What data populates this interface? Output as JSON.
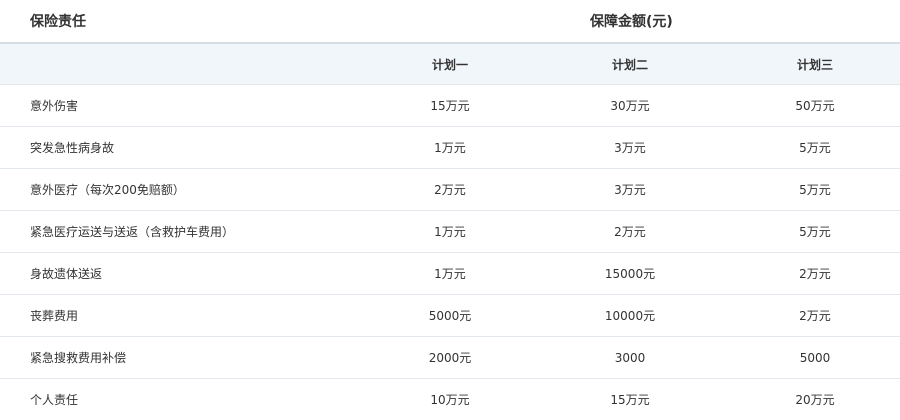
{
  "table": {
    "header_left": "保险责任",
    "header_right": "保障金额(元)",
    "plans": [
      "计划一",
      "计划二",
      "计划三"
    ],
    "rows": [
      {
        "item": "意外伤害",
        "plan1": "15万元",
        "plan2": "30万元",
        "plan3": "50万元"
      },
      {
        "item": "突发急性病身故",
        "plan1": "1万元",
        "plan2": "3万元",
        "plan3": "5万元"
      },
      {
        "item": "意外医疗（每次200免赔额）",
        "plan1": "2万元",
        "plan2": "3万元",
        "plan3": "5万元"
      },
      {
        "item": "紧急医疗运送与送返（含救护车费用）",
        "plan1": "1万元",
        "plan2": "2万元",
        "plan3": "5万元"
      },
      {
        "item": "身故遗体送返",
        "plan1": "1万元",
        "plan2": "15000元",
        "plan3": "2万元"
      },
      {
        "item": "丧葬费用",
        "plan1": "5000元",
        "plan2": "10000元",
        "plan3": "2万元"
      },
      {
        "item": "紧急搜救费用补偿",
        "plan1": "2000元",
        "plan2": "3000",
        "plan3": "5000"
      },
      {
        "item": "个人责任",
        "plan1": "10万元",
        "plan2": "15万元",
        "plan3": "20万元"
      }
    ]
  }
}
